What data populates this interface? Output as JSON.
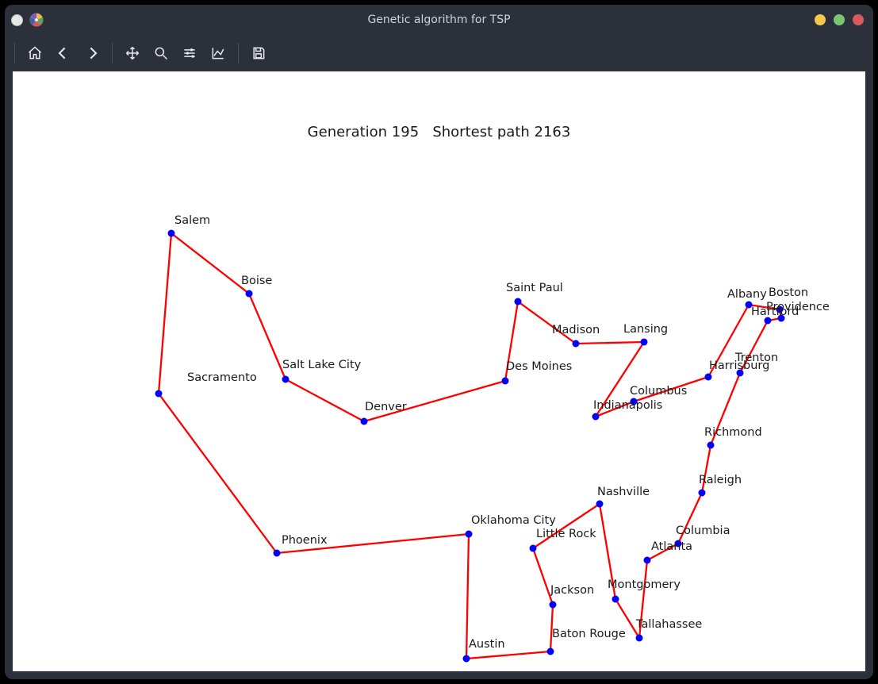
{
  "window": {
    "title": "Genetic algorithm for TSP"
  },
  "toolbar": {
    "home": "Home",
    "back": "Back",
    "forward": "Forward",
    "pan": "Pan",
    "zoom": "Zoom",
    "subplots": "Configure subplots",
    "axes": "Edit axis",
    "save": "Save"
  },
  "plot": {
    "title": "Generation 195   Shortest path 2163"
  },
  "chart_data": {
    "type": "scatter",
    "title": "Generation 195   Shortest path 2163",
    "generation": 195,
    "shortest_path": 2163,
    "xlabel": "",
    "ylabel": "",
    "xlim": [
      150,
      1060
    ],
    "ylim": [
      740,
      100
    ],
    "line_color": "#ff0000",
    "marker_color": "#0000ff",
    "cities": {
      "Salem": {
        "x": 200,
        "y": 204,
        "lx": 204,
        "ly": 192
      },
      "Boise": {
        "x": 298,
        "y": 280,
        "lx": 288,
        "ly": 268
      },
      "Salt Lake City": {
        "x": 344,
        "y": 388,
        "lx": 340,
        "ly": 374
      },
      "Denver": {
        "x": 443,
        "y": 441,
        "lx": 444,
        "ly": 427
      },
      "Des Moines": {
        "x": 621,
        "y": 390,
        "lx": 622,
        "ly": 376
      },
      "Saint Paul": {
        "x": 637,
        "y": 290,
        "lx": 622,
        "ly": 277
      },
      "Madison": {
        "x": 710,
        "y": 343,
        "lx": 680,
        "ly": 330
      },
      "Lansing": {
        "x": 796,
        "y": 341,
        "lx": 770,
        "ly": 329
      },
      "Indianapolis": {
        "x": 735,
        "y": 435,
        "lx": 732,
        "ly": 425
      },
      "Columbus": {
        "x": 783,
        "y": 416,
        "lx": 778,
        "ly": 407
      },
      "Harrisburg": {
        "x": 877,
        "y": 385,
        "lx": 878,
        "ly": 375
      },
      "Albany": {
        "x": 928,
        "y": 294,
        "lx": 901,
        "ly": 285
      },
      "Boston": {
        "x": 967,
        "y": 300,
        "lx": 953,
        "ly": 283
      },
      "Providence": {
        "x": 969,
        "y": 311,
        "lx": 950,
        "ly": 301
      },
      "Hartford": {
        "x": 952,
        "y": 314,
        "lx": 931,
        "ly": 307
      },
      "Trenton": {
        "x": 917,
        "y": 380,
        "lx": 911,
        "ly": 365
      },
      "Richmond": {
        "x": 880,
        "y": 471,
        "lx": 872,
        "ly": 459
      },
      "Raleigh": {
        "x": 869,
        "y": 531,
        "lx": 865,
        "ly": 519
      },
      "Columbia": {
        "x": 839,
        "y": 595,
        "lx": 836,
        "ly": 583
      },
      "Atlanta": {
        "x": 800,
        "y": 616,
        "lx": 805,
        "ly": 603
      },
      "Tallahassee": {
        "x": 790,
        "y": 714,
        "lx": 786,
        "ly": 701
      },
      "Montgomery": {
        "x": 760,
        "y": 665,
        "lx": 750,
        "ly": 651
      },
      "Nashville": {
        "x": 740,
        "y": 545,
        "lx": 737,
        "ly": 534
      },
      "Little Rock": {
        "x": 656,
        "y": 601,
        "lx": 660,
        "ly": 587
      },
      "Jackson": {
        "x": 681,
        "y": 672,
        "lx": 678,
        "ly": 658
      },
      "Baton Rouge": {
        "x": 678,
        "y": 731,
        "lx": 680,
        "ly": 713
      },
      "Austin": {
        "x": 572,
        "y": 740,
        "lx": 575,
        "ly": 726
      },
      "Oklahoma City": {
        "x": 575,
        "y": 583,
        "lx": 578,
        "ly": 570
      },
      "Phoenix": {
        "x": 333,
        "y": 607,
        "lx": 339,
        "ly": 595
      },
      "Sacramento": {
        "x": 184,
        "y": 406,
        "lx": 220,
        "ly": 390
      }
    },
    "tour": [
      "Salem",
      "Boise",
      "Salt Lake City",
      "Denver",
      "Des Moines",
      "Saint Paul",
      "Madison",
      "Lansing",
      "Indianapolis",
      "Columbus",
      "Harrisburg",
      "Albany",
      "Boston",
      "Providence",
      "Hartford",
      "Trenton",
      "Richmond",
      "Raleigh",
      "Columbia",
      "Atlanta",
      "Tallahassee",
      "Montgomery",
      "Nashville",
      "Little Rock",
      "Jackson",
      "Baton Rouge",
      "Austin",
      "Oklahoma City",
      "Phoenix",
      "Sacramento",
      "Salem"
    ]
  }
}
